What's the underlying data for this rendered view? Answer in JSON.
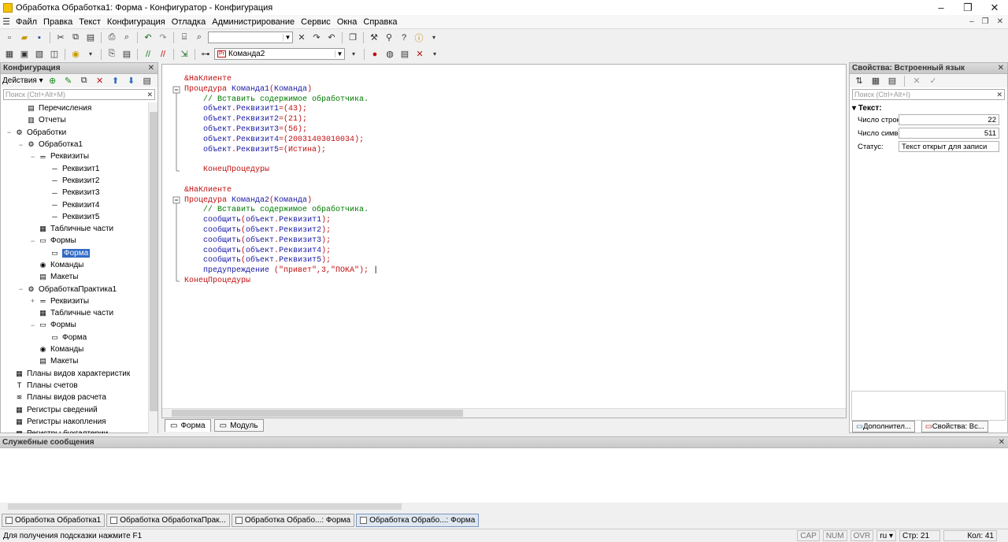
{
  "window": {
    "title": "Обработка Обработка1: Форма - Конфигуратор - Конфигурация",
    "minimize": "–",
    "maximize": "❐",
    "close": "✕"
  },
  "menu": {
    "items": [
      "Файл",
      "Правка",
      "Текст",
      "Конфигурация",
      "Отладка",
      "Администрирование",
      "Сервис",
      "Окна",
      "Справка"
    ],
    "mdi_min": "–",
    "mdi_restore": "❐",
    "mdi_close": "✕"
  },
  "toolbar2": {
    "method_combo": "Команда2",
    "method_combo_prefix": "Pr"
  },
  "left_panel": {
    "title": "Конфигурация",
    "close": "✕",
    "actions_label": "Действия",
    "search_placeholder": "Поиск (Ctrl+Alt+M)",
    "tree": [
      {
        "label": "Перечисления",
        "level": 1,
        "icon": "enum-icon"
      },
      {
        "label": "Отчеты",
        "level": 1,
        "icon": "report-icon"
      },
      {
        "label": "Обработки",
        "level": 0,
        "expander": "−",
        "icon": "processing-icon"
      },
      {
        "label": "Обработка1",
        "level": 1,
        "expander": "−",
        "icon": "processing-icon"
      },
      {
        "label": "Реквизиты",
        "level": 2,
        "expander": "−",
        "icon": "attributes-icon"
      },
      {
        "label": "Реквизит1",
        "level": 3,
        "icon": "attribute-icon"
      },
      {
        "label": "Реквизит2",
        "level": 3,
        "icon": "attribute-icon"
      },
      {
        "label": "Реквизит3",
        "level": 3,
        "icon": "attribute-icon"
      },
      {
        "label": "Реквизит4",
        "level": 3,
        "icon": "attribute-icon"
      },
      {
        "label": "Реквизит5",
        "level": 3,
        "icon": "attribute-icon"
      },
      {
        "label": "Табличные части",
        "level": 2,
        "icon": "table-icon"
      },
      {
        "label": "Формы",
        "level": 2,
        "expander": "−",
        "icon": "form-icon"
      },
      {
        "label": "Форма",
        "level": 3,
        "icon": "form-icon",
        "selected": true
      },
      {
        "label": "Команды",
        "level": 2,
        "icon": "command-icon"
      },
      {
        "label": "Макеты",
        "level": 2,
        "icon": "template-icon"
      },
      {
        "label": "ОбработкаПрактика1",
        "level": 1,
        "expander": "−",
        "icon": "processing-icon"
      },
      {
        "label": "Реквизиты",
        "level": 2,
        "expander": "+",
        "icon": "attributes-icon"
      },
      {
        "label": "Табличные части",
        "level": 2,
        "icon": "table-icon"
      },
      {
        "label": "Формы",
        "level": 2,
        "expander": "−",
        "icon": "form-icon"
      },
      {
        "label": "Форма",
        "level": 3,
        "icon": "form-icon"
      },
      {
        "label": "Команды",
        "level": 2,
        "icon": "command-icon"
      },
      {
        "label": "Макеты",
        "level": 2,
        "icon": "template-icon"
      },
      {
        "label": "Планы видов характеристик",
        "level": 0,
        "icon": "chart-types-icon"
      },
      {
        "label": "Планы счетов",
        "level": 0,
        "icon": "accounts-icon"
      },
      {
        "label": "Планы видов расчета",
        "level": 0,
        "icon": "calc-types-icon"
      },
      {
        "label": "Регистры сведений",
        "level": 0,
        "icon": "register-icon"
      },
      {
        "label": "Регистры накопления",
        "level": 0,
        "icon": "register-icon"
      },
      {
        "label": "Регистры бухгалтерии",
        "level": 0,
        "icon": "register-icon"
      }
    ]
  },
  "editor": {
    "lines": [
      [
        {
          "t": "&НаКлиенте",
          "c": "kw"
        }
      ],
      [
        {
          "t": "Процедура ",
          "c": "kw"
        },
        {
          "t": "Команда1",
          "c": "id"
        },
        {
          "t": "(",
          "c": "pn"
        },
        {
          "t": "Команда",
          "c": "id"
        },
        {
          "t": ")",
          "c": "pn"
        }
      ],
      [
        {
          "t": "    // Вставить содержимое обработчика.",
          "c": "cm"
        }
      ],
      [
        {
          "t": "    объект",
          "c": "id"
        },
        {
          "t": ".",
          "c": "pn"
        },
        {
          "t": "Реквизит1",
          "c": "id"
        },
        {
          "t": "=(43);",
          "c": "pn"
        }
      ],
      [
        {
          "t": "    объект",
          "c": "id"
        },
        {
          "t": ".",
          "c": "pn"
        },
        {
          "t": "Реквизит2",
          "c": "id"
        },
        {
          "t": "=(21);",
          "c": "pn"
        }
      ],
      [
        {
          "t": "    объект",
          "c": "id"
        },
        {
          "t": ".",
          "c": "pn"
        },
        {
          "t": "Реквизит3",
          "c": "id"
        },
        {
          "t": "=(56);",
          "c": "pn"
        }
      ],
      [
        {
          "t": "    объект",
          "c": "id"
        },
        {
          "t": ".",
          "c": "pn"
        },
        {
          "t": "Реквизит4",
          "c": "id"
        },
        {
          "t": "=(20031403010034);",
          "c": "pn"
        }
      ],
      [
        {
          "t": "    объект",
          "c": "id"
        },
        {
          "t": ".",
          "c": "pn"
        },
        {
          "t": "Реквизит5",
          "c": "id"
        },
        {
          "t": "=(Истина);",
          "c": "pn"
        }
      ],
      [
        {
          "t": "",
          "c": "pn"
        }
      ],
      [
        {
          "t": "    КонецПроцедуры",
          "c": "kw"
        }
      ],
      [
        {
          "t": "",
          "c": "pn"
        }
      ],
      [
        {
          "t": "&НаКлиенте",
          "c": "kw"
        }
      ],
      [
        {
          "t": "Процедура ",
          "c": "kw"
        },
        {
          "t": "Команда2",
          "c": "id"
        },
        {
          "t": "(",
          "c": "pn"
        },
        {
          "t": "Команда",
          "c": "id"
        },
        {
          "t": ")",
          "c": "pn"
        }
      ],
      [
        {
          "t": "    // Вставить содержимое обработчика.",
          "c": "cm"
        }
      ],
      [
        {
          "t": "    сообщить",
          "c": "id"
        },
        {
          "t": "(",
          "c": "pn"
        },
        {
          "t": "объект",
          "c": "id"
        },
        {
          "t": ".",
          "c": "pn"
        },
        {
          "t": "Реквизит1",
          "c": "id"
        },
        {
          "t": ");",
          "c": "pn"
        }
      ],
      [
        {
          "t": "    сообщить",
          "c": "id"
        },
        {
          "t": "(",
          "c": "pn"
        },
        {
          "t": "объект",
          "c": "id"
        },
        {
          "t": ".",
          "c": "pn"
        },
        {
          "t": "Реквизит2",
          "c": "id"
        },
        {
          "t": ");",
          "c": "pn"
        }
      ],
      [
        {
          "t": "    сообщить",
          "c": "id"
        },
        {
          "t": "(",
          "c": "pn"
        },
        {
          "t": "объект",
          "c": "id"
        },
        {
          "t": ".",
          "c": "pn"
        },
        {
          "t": "Реквизит3",
          "c": "id"
        },
        {
          "t": ");",
          "c": "pn"
        }
      ],
      [
        {
          "t": "    сообщить",
          "c": "id"
        },
        {
          "t": "(",
          "c": "pn"
        },
        {
          "t": "объект",
          "c": "id"
        },
        {
          "t": ".",
          "c": "pn"
        },
        {
          "t": "Реквизит4",
          "c": "id"
        },
        {
          "t": ");",
          "c": "pn"
        }
      ],
      [
        {
          "t": "    сообщить",
          "c": "id"
        },
        {
          "t": "(",
          "c": "pn"
        },
        {
          "t": "объект",
          "c": "id"
        },
        {
          "t": ".",
          "c": "pn"
        },
        {
          "t": "Реквизит5",
          "c": "id"
        },
        {
          "t": ");",
          "c": "pn"
        }
      ],
      [
        {
          "t": "    предупреждение ",
          "c": "id"
        },
        {
          "t": "(\"привет\",3,\"ПОКА\"); ",
          "c": "pn"
        },
        {
          "t": "|",
          "c": "cursor"
        }
      ],
      [
        {
          "t": "КонецПроцедуры",
          "c": "kw"
        }
      ]
    ],
    "tabs": [
      {
        "label": "Форма",
        "active": true
      },
      {
        "label": "Модуль",
        "active": false
      }
    ]
  },
  "right_panel": {
    "title": "Свойства: Встроенный язык",
    "close": "✕",
    "search_placeholder": "Поиск (Ctrl+Alt+I)",
    "group": "Текст:",
    "props": [
      {
        "label": "Число строк:",
        "value": "22",
        "num": true
      },
      {
        "label": "Число символов:",
        "value": "511",
        "num": true
      },
      {
        "label": "Статус:",
        "value": "Текст открыт для записи",
        "num": false
      }
    ],
    "tabs": [
      "Дополнител...",
      "Свойства: Вс..."
    ]
  },
  "messages": {
    "title": "Служебные сообщения",
    "close": "✕"
  },
  "window_tabs": [
    {
      "label": "Обработка Обработка1",
      "active": false
    },
    {
      "label": "Обработка ОбработкаПрак...",
      "active": false
    },
    {
      "label": "Обработка Обрабо...: Форма",
      "active": false
    },
    {
      "label": "Обработка Обрабо...: Форма",
      "active": true
    }
  ],
  "status": {
    "hint": "Для получения подсказки нажмите F1",
    "cap": "CAP",
    "num": "NUM",
    "ovr": "OVR",
    "lang": "ru",
    "line": "Стр: 21",
    "col": "Кол: 41"
  }
}
